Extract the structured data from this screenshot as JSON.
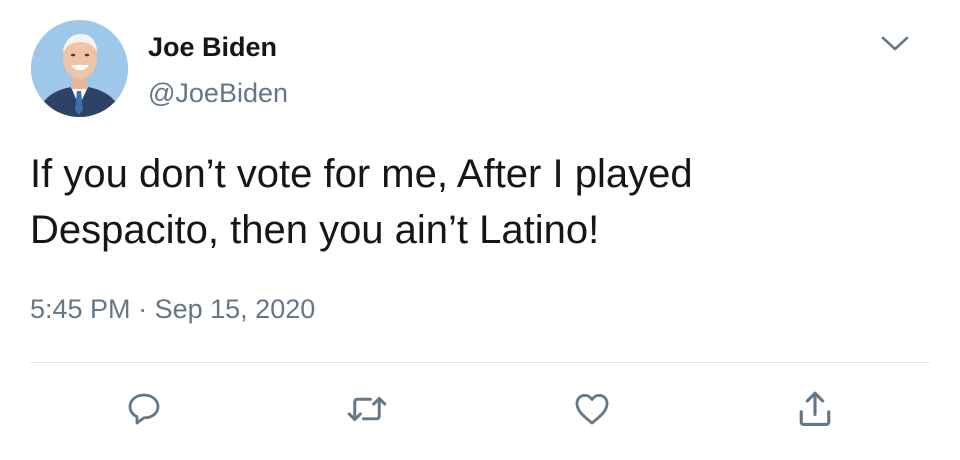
{
  "author": {
    "display_name": "Joe Biden",
    "handle": "@JoeBiden",
    "avatar_icon": "profile-photo"
  },
  "tweet": {
    "text_line1": "If you don’t vote for me, After I played",
    "text_line2": "Despacito, then you ain’t Latino!",
    "time": "5:45 PM",
    "separator": "·",
    "date": "Sep 15, 2020"
  },
  "actions": [
    {
      "name": "reply",
      "icon": "speech-bubble-icon"
    },
    {
      "name": "retweet",
      "icon": "retweet-arrows-icon"
    },
    {
      "name": "like",
      "icon": "heart-icon"
    },
    {
      "name": "share",
      "icon": "share-upload-icon"
    }
  ],
  "colors": {
    "text_primary": "#14171a",
    "text_secondary": "#657786",
    "divider": "#e1e8ed",
    "icon": "#657786"
  }
}
